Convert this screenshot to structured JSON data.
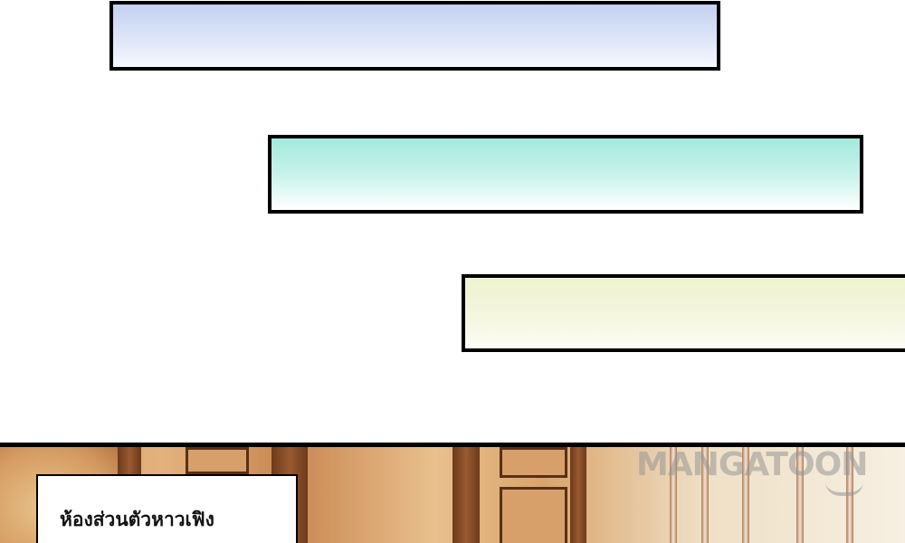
{
  "panels": {
    "caption": "ห้องส่วนตัวหาวเฟิง",
    "watermark": "MANGATOON"
  },
  "colors": {
    "box_blue": "#c3d0ef",
    "box_teal": "#a3e9dd",
    "box_cream": "#eef3cf",
    "border": "#000000",
    "scene_wood": "#d59b62"
  }
}
